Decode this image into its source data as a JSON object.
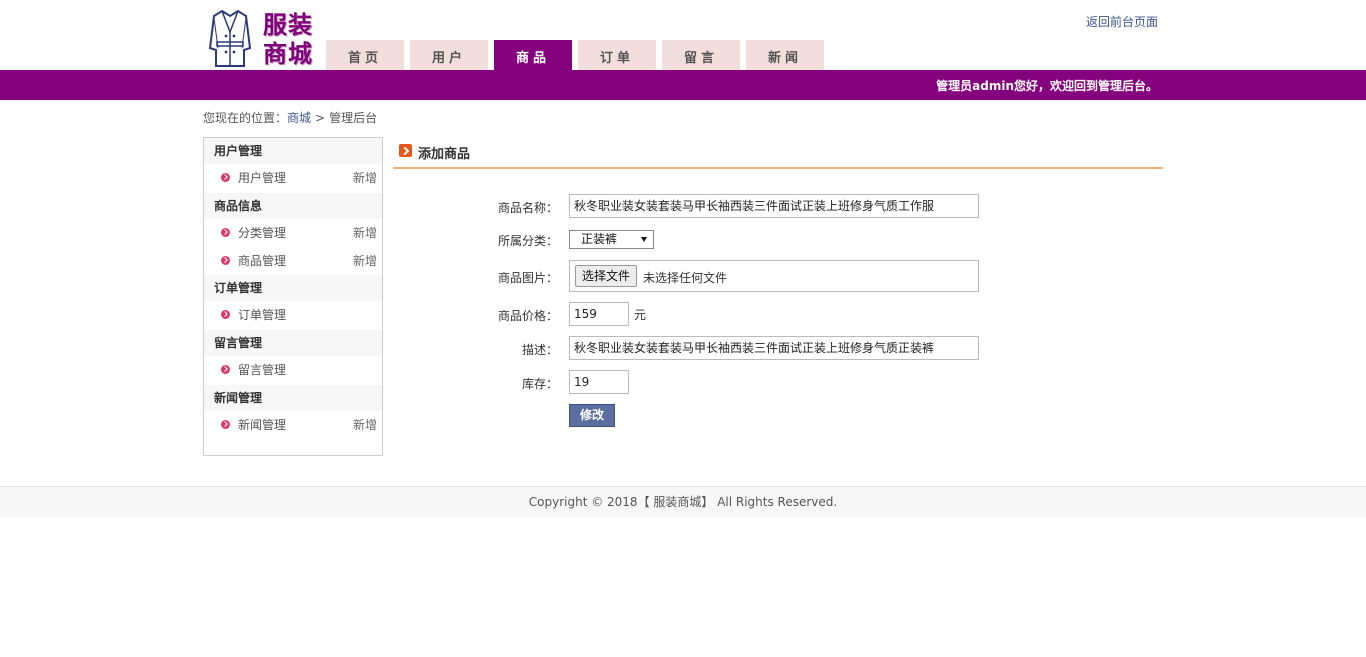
{
  "header": {
    "logo_text_line1": "服装",
    "logo_text_line2": "商城",
    "back_link": "返回前台页面",
    "welcome": "管理员admin您好，欢迎回到管理后台。",
    "nav_tabs": [
      {
        "label": "首页",
        "active": false
      },
      {
        "label": "用户",
        "active": false
      },
      {
        "label": "商品",
        "active": true
      },
      {
        "label": "订单",
        "active": false
      },
      {
        "label": "留言",
        "active": false
      },
      {
        "label": "新闻",
        "active": false
      }
    ]
  },
  "breadcrumb": {
    "prefix": "您现在的位置：",
    "link": "商城",
    "separator": ">",
    "current": "管理后台"
  },
  "sidebar": {
    "groups": [
      {
        "title": "用户管理",
        "items": [
          {
            "label": "用户管理",
            "add": "新增"
          }
        ]
      },
      {
        "title": "商品信息",
        "items": [
          {
            "label": "分类管理",
            "add": "新增"
          },
          {
            "label": "商品管理",
            "add": "新增"
          }
        ]
      },
      {
        "title": "订单管理",
        "items": [
          {
            "label": "订单管理",
            "add": ""
          }
        ]
      },
      {
        "title": "留言管理",
        "items": [
          {
            "label": "留言管理",
            "add": ""
          }
        ]
      },
      {
        "title": "新闻管理",
        "items": [
          {
            "label": "新闻管理",
            "add": "新增"
          }
        ]
      }
    ]
  },
  "main": {
    "title": "添加商品",
    "form": {
      "name_label": "商品名称：",
      "name_value": "秋冬职业装女装套装马甲长袖西装三件面试正装上班修身气质工作服",
      "category_label": "所属分类：",
      "category_value": "正装裤",
      "image_label": "商品图片：",
      "file_button": "选择文件",
      "file_status": "未选择任何文件",
      "price_label": "商品价格：",
      "price_value": "159",
      "price_unit": "元",
      "desc_label": "描述：",
      "desc_value": "秋冬职业装女装套装马甲长袖西装三件面试正装上班修身气质正装裤",
      "stock_label": "库存：",
      "stock_value": "19",
      "submit_label": "修改"
    }
  },
  "footer": {
    "copyright": "Copyright © 2018【 服装商城】 All Rights Reserved."
  },
  "colors": {
    "brand": "#85007d",
    "tab_inactive": "#f3dede",
    "title_underline": "#f0b070",
    "button": "#5a6fa0",
    "bullet": "#d93a6c"
  }
}
